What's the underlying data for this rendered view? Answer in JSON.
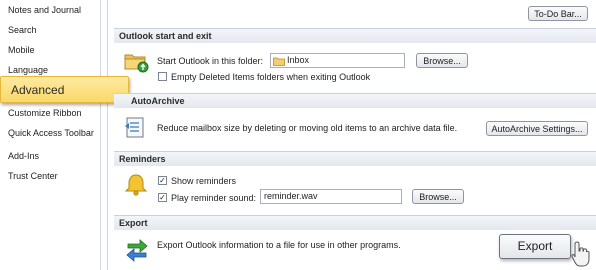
{
  "sidebar": {
    "items": [
      {
        "label": "Notes and Journal"
      },
      {
        "label": "Search"
      },
      {
        "label": "Mobile"
      },
      {
        "label": "Language"
      },
      {
        "label": "Advanced"
      },
      {
        "label": "Customize Ribbon"
      },
      {
        "label": "Quick Access Toolbar"
      },
      {
        "label": "Add-Ins"
      },
      {
        "label": "Trust Center"
      }
    ],
    "selected": "Advanced"
  },
  "toolbar": {
    "todo_bar_button": "To-Do Bar..."
  },
  "start_exit": {
    "header": "Outlook start and exit",
    "start_folder_label": "Start Outlook in this folder:",
    "start_folder_value": "Inbox",
    "browse_label": "Browse...",
    "empty_deleted_label": "Empty Deleted Items folders when exiting Outlook",
    "empty_deleted_checked": false
  },
  "autoarchive": {
    "header": "AutoArchive",
    "description": "Reduce mailbox size by deleting or moving old items to an archive data file.",
    "button_label": "AutoArchive Settings..."
  },
  "reminders": {
    "header": "Reminders",
    "show_reminders_label": "Show reminders",
    "show_reminders_checked": true,
    "play_sound_label": "Play reminder sound:",
    "play_sound_checked": true,
    "sound_file": "reminder.wav",
    "browse_label": "Browse..."
  },
  "export": {
    "header": "Export",
    "description": "Export Outlook information to a file for use in other programs.",
    "button_label": "Export"
  },
  "colors": {
    "selected_bg": "#fad96a",
    "selected_border": "#e6b738",
    "section_bg": "#e3e8ee"
  }
}
